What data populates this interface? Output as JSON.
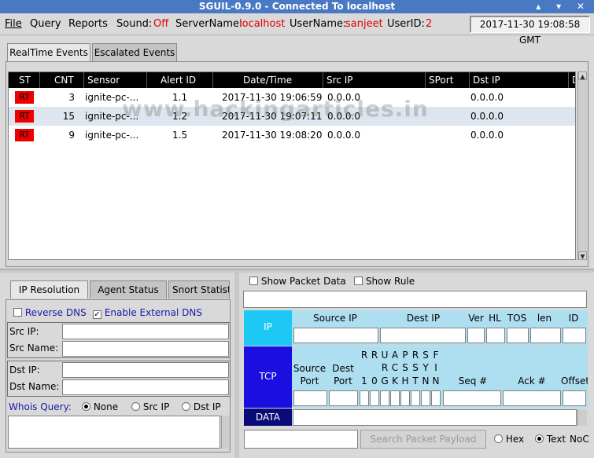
{
  "window": {
    "title": "SGUIL-0.9.0 - Connected To localhost",
    "controls": "▴ ▾ ✕"
  },
  "menu": {
    "file": "File",
    "query": "Query",
    "reports": "Reports",
    "sound_label": "Sound:",
    "sound_value": "Off",
    "server_label": "ServerName:",
    "server_value": "localhost",
    "user_label": "UserName:",
    "user_value": "sanjeet",
    "userid_label": "UserID:",
    "userid_value": "2",
    "clock": "2017-11-30 19:08:58 GMT"
  },
  "tabs": {
    "realtime": "RealTime Events",
    "escalated": "Escalated Events"
  },
  "events": {
    "columns": [
      "ST",
      "CNT",
      "Sensor",
      "Alert ID",
      "Date/Time",
      "Src IP",
      "SPort",
      "Dst IP",
      "D"
    ],
    "rows": [
      {
        "st": "RT",
        "cnt": "3",
        "sensor": "ignite-pc-...",
        "alert_id": "1.1",
        "datetime": "2017-11-30 19:06:59",
        "src_ip": "0.0.0.0",
        "dst_ip": "0.0.0.0"
      },
      {
        "st": "RT",
        "cnt": "15",
        "sensor": "ignite-pc-...",
        "alert_id": "1.2",
        "datetime": "2017-11-30 19:07:11",
        "src_ip": "0.0.0.0",
        "dst_ip": "0.0.0.0"
      },
      {
        "st": "RT",
        "cnt": "9",
        "sensor": "ignite-pc-...",
        "alert_id": "1.5",
        "datetime": "2017-11-30 19:08:20",
        "src_ip": "0.0.0.0",
        "dst_ip": "0.0.0.0"
      }
    ],
    "watermark": "www.hackingarticles.in"
  },
  "lower_tabs": {
    "ip": "IP Resolution",
    "agent": "Agent Status",
    "snort": "Snort Statist"
  },
  "ip_resolution": {
    "reverse_dns": "Reverse DNS",
    "enable_external_dns": "Enable External DNS",
    "src_ip": "Src IP:",
    "src_name": "Src Name:",
    "dst_ip": "Dst IP:",
    "dst_name": "Dst Name:",
    "whois_label": "Whois Query:",
    "whois_none": "None",
    "whois_src": "Src IP",
    "whois_dst": "Dst IP"
  },
  "packet": {
    "show_packet_data": "Show Packet Data",
    "show_rule": "Show Rule",
    "ip_label": "IP",
    "source_ip": "Source IP",
    "dest_ip": "Dest IP",
    "ver": "Ver",
    "hl": "HL",
    "tos": "TOS",
    "len": "len",
    "id": "ID",
    "tcp_label": "TCP",
    "source_port": "Source Port",
    "dest_port": "Dest Port",
    "flags_top": [
      "R",
      "R",
      "U",
      "A",
      "P",
      "R",
      "S",
      "F"
    ],
    "flags_mid": [
      "",
      "",
      "R",
      "C",
      "S",
      "S",
      "Y",
      "I"
    ],
    "flags_bot": [
      "1",
      "0",
      "G",
      "K",
      "H",
      "T",
      "N",
      "N"
    ],
    "seq": "Seq #",
    "ack": "Ack #",
    "offset": "Offset",
    "data_label": "DATA",
    "search_payload": "Search Packet Payload",
    "hex": "Hex",
    "text": "Text",
    "nocase": "NoC"
  }
}
